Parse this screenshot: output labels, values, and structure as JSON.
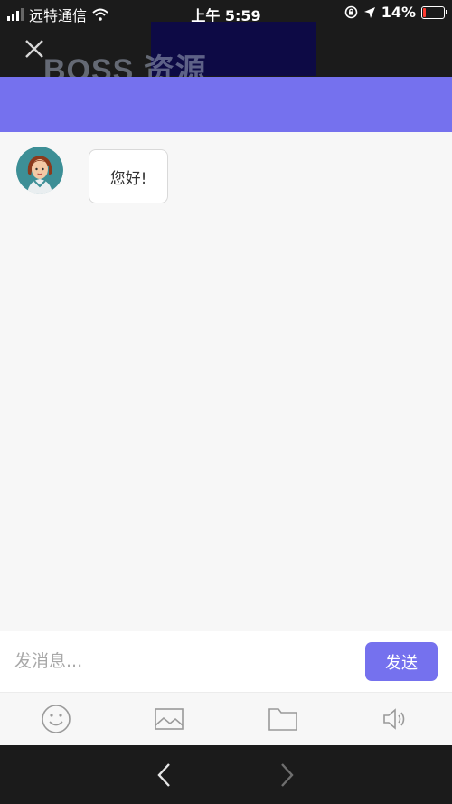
{
  "status_bar": {
    "carrier": "远特通信",
    "time": "上午 5:59",
    "battery_percent": "14%",
    "battery_level": 0.14,
    "icons": [
      "signal-icon",
      "wifi-icon",
      "orientation-lock-icon",
      "location-arrow-icon",
      "battery-icon"
    ]
  },
  "nav": {
    "close_icon": "close-icon",
    "watermark": "BOSS 资源"
  },
  "theme": {
    "accent": "#7571ee",
    "dark": "#1b1b1b",
    "background": "#f7f7f7"
  },
  "chat": {
    "messages": [
      {
        "sender": "agent",
        "avatar": "female-agent-avatar",
        "text": "您好!"
      }
    ]
  },
  "composer": {
    "placeholder": "发消息...",
    "value": "",
    "send_label": "发送"
  },
  "toolbar": {
    "items": [
      "emoji-icon",
      "image-icon",
      "folder-icon",
      "speaker-icon"
    ]
  },
  "browser_nav": {
    "items": [
      "back-arrow-icon",
      "forward-arrow-icon"
    ]
  }
}
